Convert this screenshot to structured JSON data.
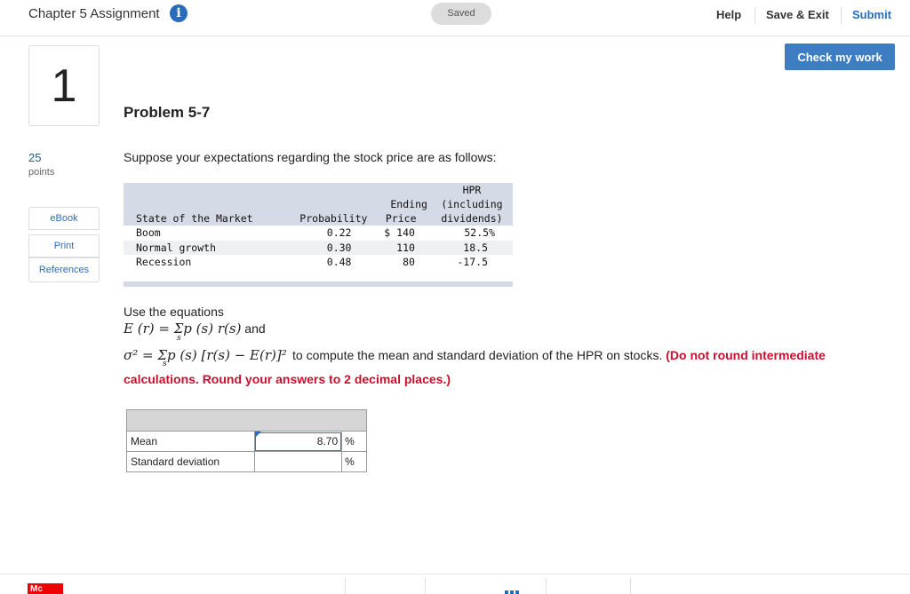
{
  "header": {
    "assignment_title": "Chapter 5 Assignment",
    "info_glyph": "i",
    "saved_label": "Saved",
    "help_label": "Help",
    "save_exit_label": "Save & Exit",
    "submit_label": "Submit",
    "accent_color": "#2a6ebb"
  },
  "check_button_label": "Check my work",
  "question": {
    "number": "1",
    "points": "25",
    "points_label": "points"
  },
  "sidebar": {
    "items": [
      {
        "label": "eBook"
      },
      {
        "label": "Print"
      },
      {
        "label": "References"
      }
    ]
  },
  "problem": {
    "title": "Problem 5-7",
    "intro": "Suppose your expectations regarding the stock price are as follows:",
    "table": {
      "headers": {
        "state": "State of the Market",
        "probability": "Probability",
        "ending_price_1": "Ending",
        "ending_price_2": "Price",
        "hpr_1": "HPR",
        "hpr_2": "(including",
        "hpr_3": "dividends)"
      },
      "rows": [
        {
          "state": "Boom",
          "probability": "0.22",
          "price": "$ 140",
          "hpr": "52.5%"
        },
        {
          "state": "Normal growth",
          "probability": "0.30",
          "price": "110",
          "hpr": "18.5"
        },
        {
          "state": "Recession",
          "probability": "0.48",
          "price": "80",
          "hpr": "-17.5"
        }
      ]
    },
    "equations_intro": "Use the equations",
    "eq1": "E (r) = Σp (s) r(s)",
    "eq1_and": " and",
    "eq_sub": "s",
    "eq2": "σ² = Σp (s) [r(s) − E(r)]²",
    "eq2_text": "to compute the mean and standard deviation of the HPR on stocks.",
    "instruction_red_1": "(Do not round intermediate",
    "instruction_red_2": "calculations. Round your answers to 2 decimal places.)"
  },
  "answers": {
    "rows": [
      {
        "label": "Mean",
        "value": "8.70",
        "unit": "%"
      },
      {
        "label": "Standard deviation",
        "value": "",
        "unit": "%"
      }
    ]
  },
  "footer": {
    "logo_text": "Mc"
  }
}
